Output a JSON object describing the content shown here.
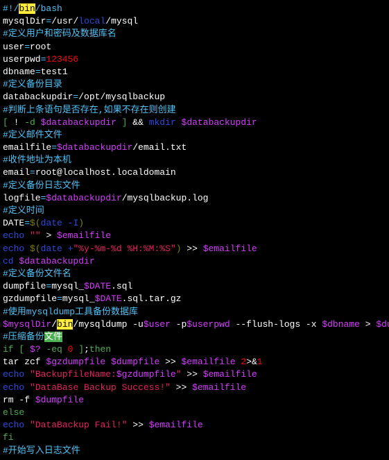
{
  "lines": [
    [
      {
        "t": "#!/",
        "c": "c-cyan"
      },
      {
        "t": "bin",
        "c": "hl-yellow"
      },
      {
        "t": "/bash",
        "c": "c-cyan"
      }
    ],
    [
      {
        "t": "mysqlDir",
        "c": "c-white"
      },
      {
        "t": "=",
        "c": "c-cyan"
      },
      {
        "t": "/usr/",
        "c": "c-white"
      },
      {
        "t": "local",
        "c": "c-blue"
      },
      {
        "t": "/mysql",
        "c": "c-white"
      }
    ],
    [
      {
        "t": "#定义用户和密码及数据库名",
        "c": "c-cyan"
      }
    ],
    [
      {
        "t": "user",
        "c": "c-white"
      },
      {
        "t": "=",
        "c": "c-cyan"
      },
      {
        "t": "root",
        "c": "c-white"
      }
    ],
    [
      {
        "t": "userpwd",
        "c": "c-white"
      },
      {
        "t": "=",
        "c": "c-cyan"
      },
      {
        "t": "123456",
        "c": "c-red"
      }
    ],
    [
      {
        "t": "dbname",
        "c": "c-white"
      },
      {
        "t": "=",
        "c": "c-cyan"
      },
      {
        "t": "test1",
        "c": "c-white"
      }
    ],
    [
      {
        "t": "#定义备份目录",
        "c": "c-cyan"
      }
    ],
    [
      {
        "t": "databackupdir",
        "c": "c-white"
      },
      {
        "t": "=",
        "c": "c-cyan"
      },
      {
        "t": "/opt/mysqlbackup",
        "c": "c-white"
      }
    ],
    [
      {
        "t": "#判断上条语句是否存在,如果不存在则创建",
        "c": "c-cyan"
      }
    ],
    [
      {
        "t": "[ ",
        "c": "c-green"
      },
      {
        "t": "! ",
        "c": "c-white"
      },
      {
        "t": "-d",
        "c": "c-green"
      },
      {
        "t": " ",
        "c": "c-white"
      },
      {
        "t": "$databackupdir",
        "c": "c-magenta"
      },
      {
        "t": " ]",
        "c": "c-green"
      },
      {
        "t": " && ",
        "c": "c-white"
      },
      {
        "t": "mkdir",
        "c": "c-blue"
      },
      {
        "t": " ",
        "c": "c-white"
      },
      {
        "t": "$databackupdir",
        "c": "c-magenta"
      }
    ],
    [
      {
        "t": "#定义邮件文件",
        "c": "c-cyan"
      }
    ],
    [
      {
        "t": "emailfile",
        "c": "c-white"
      },
      {
        "t": "=",
        "c": "c-cyan"
      },
      {
        "t": "$databackupdir",
        "c": "c-magenta"
      },
      {
        "t": "/email.txt",
        "c": "c-white"
      }
    ],
    [
      {
        "t": "#收件地址为本机",
        "c": "c-cyan"
      }
    ],
    [
      {
        "t": "email",
        "c": "c-white"
      },
      {
        "t": "=",
        "c": "c-cyan"
      },
      {
        "t": "root@localhost.localdomain",
        "c": "c-white"
      }
    ],
    [
      {
        "t": "#定义备份日志文件",
        "c": "c-cyan"
      }
    ],
    [
      {
        "t": "logfile",
        "c": "c-white"
      },
      {
        "t": "=",
        "c": "c-cyan"
      },
      {
        "t": "$databackupdir",
        "c": "c-magenta"
      },
      {
        "t": "/mysqlbackup.log",
        "c": "c-white"
      }
    ],
    [
      {
        "t": "#定义时间",
        "c": "c-cyan"
      }
    ],
    [
      {
        "t": "DATE",
        "c": "c-white"
      },
      {
        "t": "=",
        "c": "c-cyan"
      },
      {
        "t": "$(",
        "c": "c-dyellow"
      },
      {
        "t": "date -I",
        "c": "c-blue"
      },
      {
        "t": ")",
        "c": "c-dyellow"
      }
    ],
    [
      {
        "t": "echo",
        "c": "c-blue"
      },
      {
        "t": " ",
        "c": "c-white"
      },
      {
        "t": "\"\"",
        "c": "c-pink"
      },
      {
        "t": " > ",
        "c": "c-white"
      },
      {
        "t": "$emailfile",
        "c": "c-magenta"
      }
    ],
    [
      {
        "t": "echo",
        "c": "c-blue"
      },
      {
        "t": " ",
        "c": "c-white"
      },
      {
        "t": "$(",
        "c": "c-dyellow"
      },
      {
        "t": "date +",
        "c": "c-blue"
      },
      {
        "t": "\"%y-%m-%d %H:%M:%S\"",
        "c": "c-pink"
      },
      {
        "t": ")",
        "c": "c-dyellow"
      },
      {
        "t": " >> ",
        "c": "c-white"
      },
      {
        "t": "$emailfile",
        "c": "c-magenta"
      }
    ],
    [
      {
        "t": "cd",
        "c": "c-blue"
      },
      {
        "t": " ",
        "c": "c-white"
      },
      {
        "t": "$databackupdir",
        "c": "c-magenta"
      }
    ],
    [
      {
        "t": "#定义备份文件名",
        "c": "c-cyan"
      }
    ],
    [
      {
        "t": "dumpfile",
        "c": "c-white"
      },
      {
        "t": "=",
        "c": "c-cyan"
      },
      {
        "t": "mysql_",
        "c": "c-white"
      },
      {
        "t": "$DATE",
        "c": "c-magenta"
      },
      {
        "t": ".sql",
        "c": "c-white"
      }
    ],
    [
      {
        "t": "gzdumpfile",
        "c": "c-white"
      },
      {
        "t": "=",
        "c": "c-cyan"
      },
      {
        "t": "mysql_",
        "c": "c-white"
      },
      {
        "t": "$DATE",
        "c": "c-magenta"
      },
      {
        "t": ".sql.tar.gz",
        "c": "c-white"
      }
    ],
    [
      {
        "t": "#使用mysqldump工具备份数据库",
        "c": "c-cyan"
      }
    ],
    [
      {
        "t": "$mysqlDir",
        "c": "c-magenta"
      },
      {
        "t": "/",
        "c": "c-white"
      },
      {
        "t": "bin",
        "c": "hl-yellow"
      },
      {
        "t": "/mysqldump -u",
        "c": "c-white"
      },
      {
        "t": "$user",
        "c": "c-magenta"
      },
      {
        "t": " -p",
        "c": "c-white"
      },
      {
        "t": "$userpwd",
        "c": "c-magenta"
      },
      {
        "t": " --flush-logs -x ",
        "c": "c-white"
      },
      {
        "t": "$dbname",
        "c": "c-magenta"
      },
      {
        "t": " > ",
        "c": "c-white"
      },
      {
        "t": "$dumpfile",
        "c": "c-magenta"
      }
    ],
    [
      {
        "t": "#压缩备份",
        "c": "c-cyan"
      },
      {
        "t": "文件",
        "c": "hl-green"
      }
    ],
    [
      {
        "t": "if",
        "c": "c-green"
      },
      {
        "t": " ",
        "c": "c-white"
      },
      {
        "t": "[ ",
        "c": "c-green"
      },
      {
        "t": "$?",
        "c": "c-magenta"
      },
      {
        "t": " -eq",
        "c": "c-green"
      },
      {
        "t": " ",
        "c": "c-white"
      },
      {
        "t": "0",
        "c": "c-red"
      },
      {
        "t": " ]",
        "c": "c-green"
      },
      {
        "t": ";",
        "c": "c-white"
      },
      {
        "t": "then",
        "c": "c-green"
      }
    ],
    [
      {
        "t": "tar zcf ",
        "c": "c-white"
      },
      {
        "t": "$gzdumpfile",
        "c": "c-magenta"
      },
      {
        "t": " ",
        "c": "c-white"
      },
      {
        "t": "$dumpfile",
        "c": "c-magenta"
      },
      {
        "t": " >> ",
        "c": "c-white"
      },
      {
        "t": "$emailfile",
        "c": "c-magenta"
      },
      {
        "t": " ",
        "c": "c-white"
      },
      {
        "t": "2",
        "c": "c-red"
      },
      {
        "t": ">&",
        "c": "c-white"
      },
      {
        "t": "1",
        "c": "c-red"
      }
    ],
    [
      {
        "t": "echo",
        "c": "c-blue"
      },
      {
        "t": " ",
        "c": "c-white"
      },
      {
        "t": "\"BackupfileName:",
        "c": "c-pink"
      },
      {
        "t": "$gzdumpfile",
        "c": "c-magenta"
      },
      {
        "t": "\"",
        "c": "c-pink"
      },
      {
        "t": " >> ",
        "c": "c-white"
      },
      {
        "t": "$emailfile",
        "c": "c-magenta"
      }
    ],
    [
      {
        "t": "echo",
        "c": "c-blue"
      },
      {
        "t": " ",
        "c": "c-white"
      },
      {
        "t": "\"DataBase Backup Success!\"",
        "c": "c-pink"
      },
      {
        "t": " >> ",
        "c": "c-white"
      },
      {
        "t": "$emailfile",
        "c": "c-magenta"
      }
    ],
    [
      {
        "t": "rm -f ",
        "c": "c-white"
      },
      {
        "t": "$dumpfile",
        "c": "c-magenta"
      }
    ],
    [
      {
        "t": "else",
        "c": "c-green"
      }
    ],
    [
      {
        "t": "echo",
        "c": "c-blue"
      },
      {
        "t": " ",
        "c": "c-white"
      },
      {
        "t": "\"DataBackup Fail!\"",
        "c": "c-pink"
      },
      {
        "t": " >> ",
        "c": "c-white"
      },
      {
        "t": "$emailfile",
        "c": "c-magenta"
      }
    ],
    [
      {
        "t": "fi",
        "c": "c-green"
      }
    ],
    [
      {
        "t": "#开始写入日志文件",
        "c": "c-cyan"
      }
    ]
  ]
}
